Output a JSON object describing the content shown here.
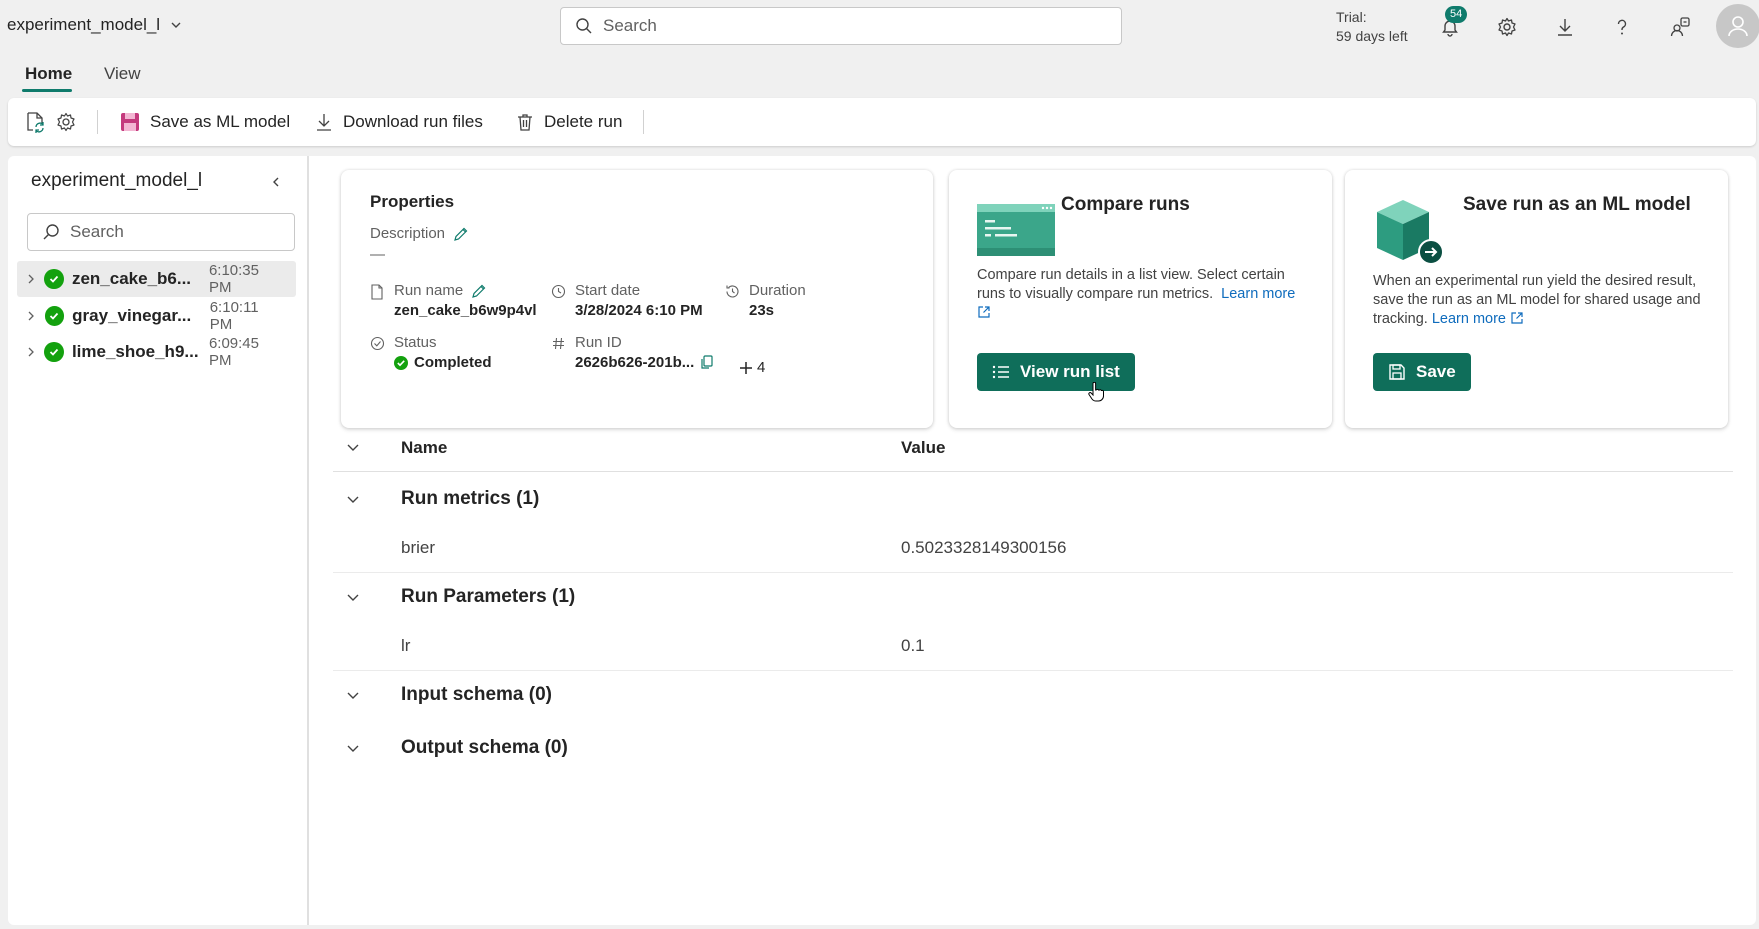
{
  "header": {
    "workspace_name": "experiment_model_l",
    "search_placeholder": "Search",
    "trial_line1": "Trial:",
    "trial_line2": "59 days left",
    "notification_count": "54"
  },
  "tabs": [
    {
      "label": "Home",
      "active": true
    },
    {
      "label": "View",
      "active": false
    }
  ],
  "toolbar": {
    "save_model_label": "Save as ML model",
    "download_label": "Download run files",
    "delete_label": "Delete run"
  },
  "sidebar": {
    "title": "experiment_model_l",
    "search_placeholder": "Search",
    "runs": [
      {
        "name": "zen_cake_b6...",
        "time": "6:10:35 PM",
        "selected": true
      },
      {
        "name": "gray_vinegar...",
        "time": "6:10:11 PM",
        "selected": false
      },
      {
        "name": "lime_shoe_h9...",
        "time": "6:09:45 PM",
        "selected": false
      }
    ]
  },
  "properties": {
    "title": "Properties",
    "description_label": "Description",
    "description_value": "—",
    "run_name_label": "Run name",
    "run_name_value": "zen_cake_b6w9p4vl",
    "start_date_label": "Start date",
    "start_date_value": "3/28/2024 6:10 PM",
    "duration_label": "Duration",
    "duration_value": "23s",
    "status_label": "Status",
    "status_value": "Completed",
    "run_id_label": "Run ID",
    "run_id_value": "2626b626-201b...",
    "more_count": "4"
  },
  "compare_card": {
    "title": "Compare runs",
    "description": "Compare run details in a list view. Select certain runs to visually compare run metrics.",
    "learn_more": "Learn more",
    "button_label": "View run list"
  },
  "save_card": {
    "title": "Save run as an ML model",
    "description": "When an experimental run yield the desired result, save the run as an ML model for shared usage and tracking.",
    "learn_more": "Learn more",
    "button_label": "Save"
  },
  "table": {
    "col_name": "Name",
    "col_value": "Value",
    "groups": [
      {
        "title": "Run metrics (1)",
        "rows": [
          {
            "name": "brier",
            "value": "0.5023328149300156"
          }
        ]
      },
      {
        "title": "Run Parameters (1)",
        "rows": [
          {
            "name": "lr",
            "value": "0.1"
          }
        ]
      },
      {
        "title": "Input schema (0)",
        "rows": []
      },
      {
        "title": "Output schema (0)",
        "rows": []
      }
    ]
  },
  "colors": {
    "accent": "#0f6e5a",
    "badge": "#0f7b6c",
    "success": "#13a10e",
    "link": "#0f6cbd"
  }
}
